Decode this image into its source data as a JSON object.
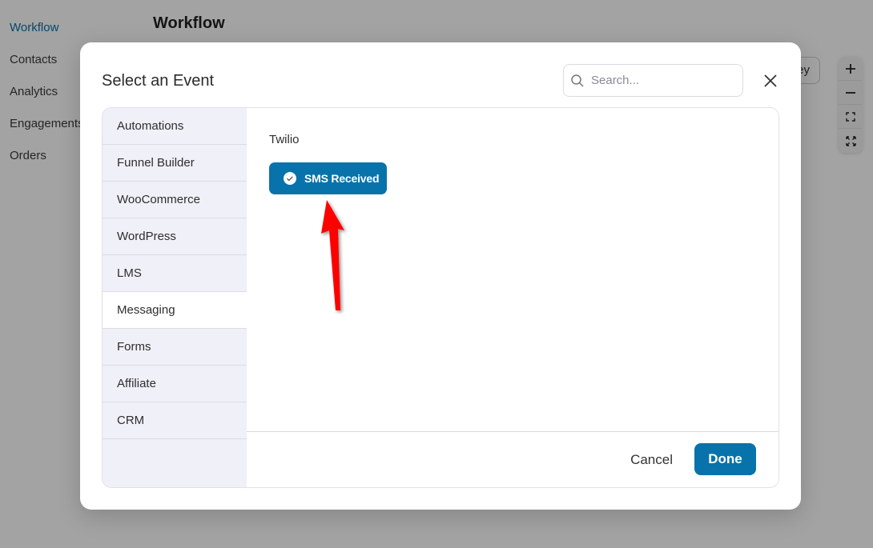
{
  "background": {
    "nav": [
      {
        "label": "Workflow",
        "active": true
      },
      {
        "label": "Contacts",
        "active": false
      },
      {
        "label": "Analytics",
        "active": false
      },
      {
        "label": "Engagements",
        "active": false
      },
      {
        "label": "Orders",
        "active": false
      }
    ],
    "page_title": "Workflow",
    "partial_button_label": "ey",
    "zoom_controls": [
      "zoom-in",
      "zoom-out",
      "fit-view",
      "fullscreen"
    ]
  },
  "modal": {
    "title": "Select an Event",
    "search": {
      "placeholder": "Search...",
      "value": ""
    },
    "categories": [
      {
        "label": "Automations",
        "active": false
      },
      {
        "label": "Funnel Builder",
        "active": false
      },
      {
        "label": "WooCommerce",
        "active": false
      },
      {
        "label": "WordPress",
        "active": false
      },
      {
        "label": "LMS",
        "active": false
      },
      {
        "label": "Messaging",
        "active": true
      },
      {
        "label": "Forms",
        "active": false
      },
      {
        "label": "Affiliate",
        "active": false
      },
      {
        "label": "CRM",
        "active": false
      }
    ],
    "group": {
      "label": "Twilio",
      "events": [
        {
          "label": "SMS Received",
          "selected": true
        }
      ]
    },
    "footer": {
      "cancel_label": "Cancel",
      "done_label": "Done"
    }
  },
  "colors": {
    "accent": "#0873ab",
    "annotation": "#ff0000",
    "sidebar_bg": "#f0f0f8"
  }
}
